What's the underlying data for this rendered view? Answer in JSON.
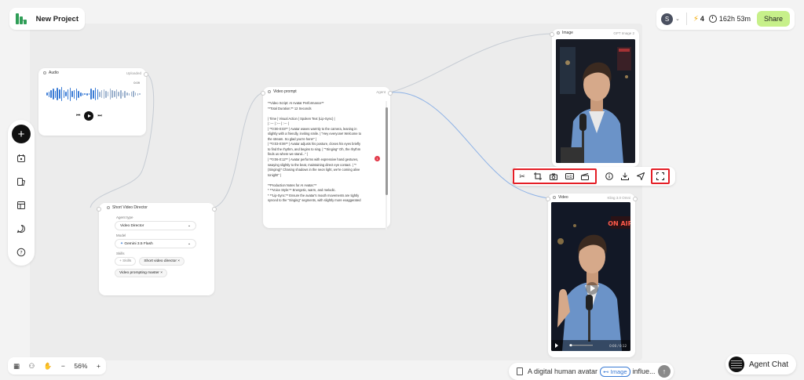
{
  "header": {
    "project_title": "New Project",
    "user_initial": "S",
    "credits": "4",
    "time_left": "162h 53m",
    "share_label": "Share"
  },
  "left_toolbar": {
    "add_label": "+",
    "icons": [
      "add-icon",
      "asset-icon",
      "layers-icon",
      "template-icon",
      "chat-icon",
      "help-icon"
    ]
  },
  "bottom_toolbar": {
    "zoom_out": "−",
    "zoom": "56%",
    "zoom_in": "+"
  },
  "nodes": {
    "audio": {
      "title": "Audio",
      "tag": "Uploaded",
      "duration": "0:09"
    },
    "director": {
      "title": "Short Video Director",
      "agent_type_label": "Agent type",
      "agent_type_value": "Video Director",
      "model_label": "Model",
      "model_value": "Gemini 3.5 Flash",
      "skills_label": "Skills",
      "add_skill_label": "+ Skills",
      "skills": [
        "Short video director",
        "Video prompting master"
      ]
    },
    "prompt": {
      "title": "Video prompt",
      "tag": "Agent",
      "badge_count": "1",
      "lines": [
        "**Video Script: AI Avatar Performance**",
        "**Total Duration:** 12 Seconds",
        "",
        "| Time | Visual Action | Spoken Text (Lip-Sync) |",
        "| :--- | :--- | :--- |",
        "| **0:00-0:03** | Avatar waves warmly to the camera, leaning in",
        "slightly with a friendly, inviting smile. | \"Hey everyone! Welcome to",
        "the stream. So glad you're here!\" |",
        "| **0:03-0:06** | Avatar adjusts his posture, closes his eyes briefly",
        "to find the rhythm, and begins to sing. | \"*Singing* Oh, the rhythm",
        "finds us where we stand...\" |",
        "| **0:06-0:12** | Avatar performs with expressive hand gestures,",
        "swaying slightly to the beat, maintaining direct eye contact. | \"*",
        "(Singing)* Chasing shadows in the neon light, we're coming alive",
        "tonight!\" |",
        "",
        "**Production Notes for AI Avatar:**",
        "*   **Voice Style:** Energetic, warm, and melodic.",
        "*   **Lip-Sync:** Ensure the avatar's mouth movements are tightly",
        "synced to the \"Singing\" segments, with slightly more exaggerated"
      ]
    },
    "image": {
      "title": "Image",
      "tag": "GPT Image 2"
    },
    "video": {
      "title": "Video",
      "tag": "Kling 3.0 Omni",
      "neon_sign": "ON AIR",
      "time": "0:00 / 0:12"
    }
  },
  "image_toolbar": {
    "icons": [
      "scissors-icon",
      "crop-icon",
      "camera-icon",
      "hd-icon",
      "clapper-icon",
      "info-icon",
      "download-icon",
      "send-icon",
      "fullscreen-icon"
    ],
    "hd_label": "HD"
  },
  "chat_input": {
    "text_before": "A digital human avatar",
    "chip_label": "Image",
    "text_after": "influe..."
  },
  "agent_chat": {
    "label": "Agent Chat"
  },
  "colors": {
    "accent_green": "#c7f08a",
    "highlight_red": "#e41e26",
    "link_blue": "#3a7bd5"
  }
}
